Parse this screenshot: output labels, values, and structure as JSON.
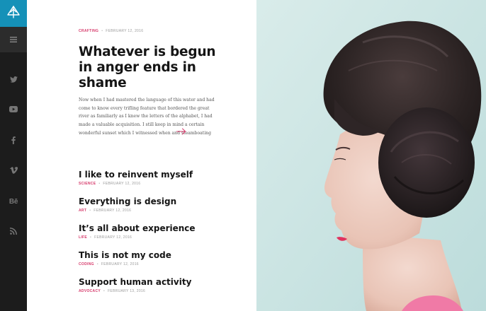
{
  "sidebar": {
    "logo_icon": "tree-arrow-logo-icon",
    "menu_icon": "hamburger-menu-icon",
    "social": [
      {
        "name": "twitter-icon"
      },
      {
        "name": "youtube-icon"
      },
      {
        "name": "facebook-icon"
      },
      {
        "name": "vimeo-icon"
      },
      {
        "name": "behance-icon",
        "label": "Bē"
      },
      {
        "name": "rss-icon"
      }
    ],
    "colors": {
      "background": "#1c1c1c",
      "logo_bg": "#1591b8",
      "menu_bg": "#2c2c2c",
      "icon": "#767676"
    }
  },
  "featured": {
    "category": "CRAFTING",
    "date": "FEBRUARY 12, 2016",
    "title": "Whatever is begun in anger ends in shame",
    "excerpt": "Now when I had mastered the language of this water and had come to know every trifling feature that bordered the great river as familiarly as I knew the letters of the alphabet, I had made a valuable acquisition. I still keep in mind a certain wonderful sunset which I witnessed when and steamboating",
    "readmore_icon": "arrow-right-icon"
  },
  "posts": [
    {
      "title": "I like to reinvent myself",
      "category": "SCIENCE",
      "date": "FEBRUARY 12, 2016"
    },
    {
      "title": "Everything is design",
      "category": "ART",
      "date": "FEBRUARY 12, 2016"
    },
    {
      "title": "It’s all about experience",
      "category": "LIFE",
      "date": "FEBRUARY 12, 2016"
    },
    {
      "title": "This is not my code",
      "category": "CODING",
      "date": "FEBRUARY 12, 2016"
    },
    {
      "title": "Support human activity",
      "category": "ADVOCACY",
      "date": "FEBRUARY 13, 2016"
    }
  ],
  "colors": {
    "accent": "#d63a6b",
    "title": "#151515",
    "meta_date": "#9a9a9a"
  }
}
